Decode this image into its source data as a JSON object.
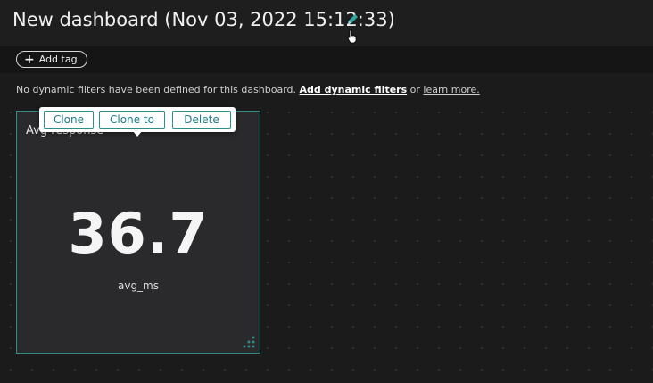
{
  "header": {
    "title": "New dashboard (Nov 03, 2022 15:12:33)",
    "edit_icon": "pencil-icon"
  },
  "tags": {
    "add_tag_label": "Add tag"
  },
  "filters": {
    "message": "No dynamic filters have been defined for this dashboard.",
    "add_link": "Add dynamic filters",
    "or_text": "or",
    "learn_link": "learn more."
  },
  "tile": {
    "title": "Avg response",
    "value": "36.7",
    "unit": "avg_ms",
    "border_color": "#2c8f8a"
  },
  "tile_toolbar": {
    "clone_label": "Clone",
    "clone_to_label": "Clone to",
    "delete_label": "Delete"
  },
  "colors": {
    "accent": "#2c8f8a",
    "background": "#1b1b1c"
  }
}
